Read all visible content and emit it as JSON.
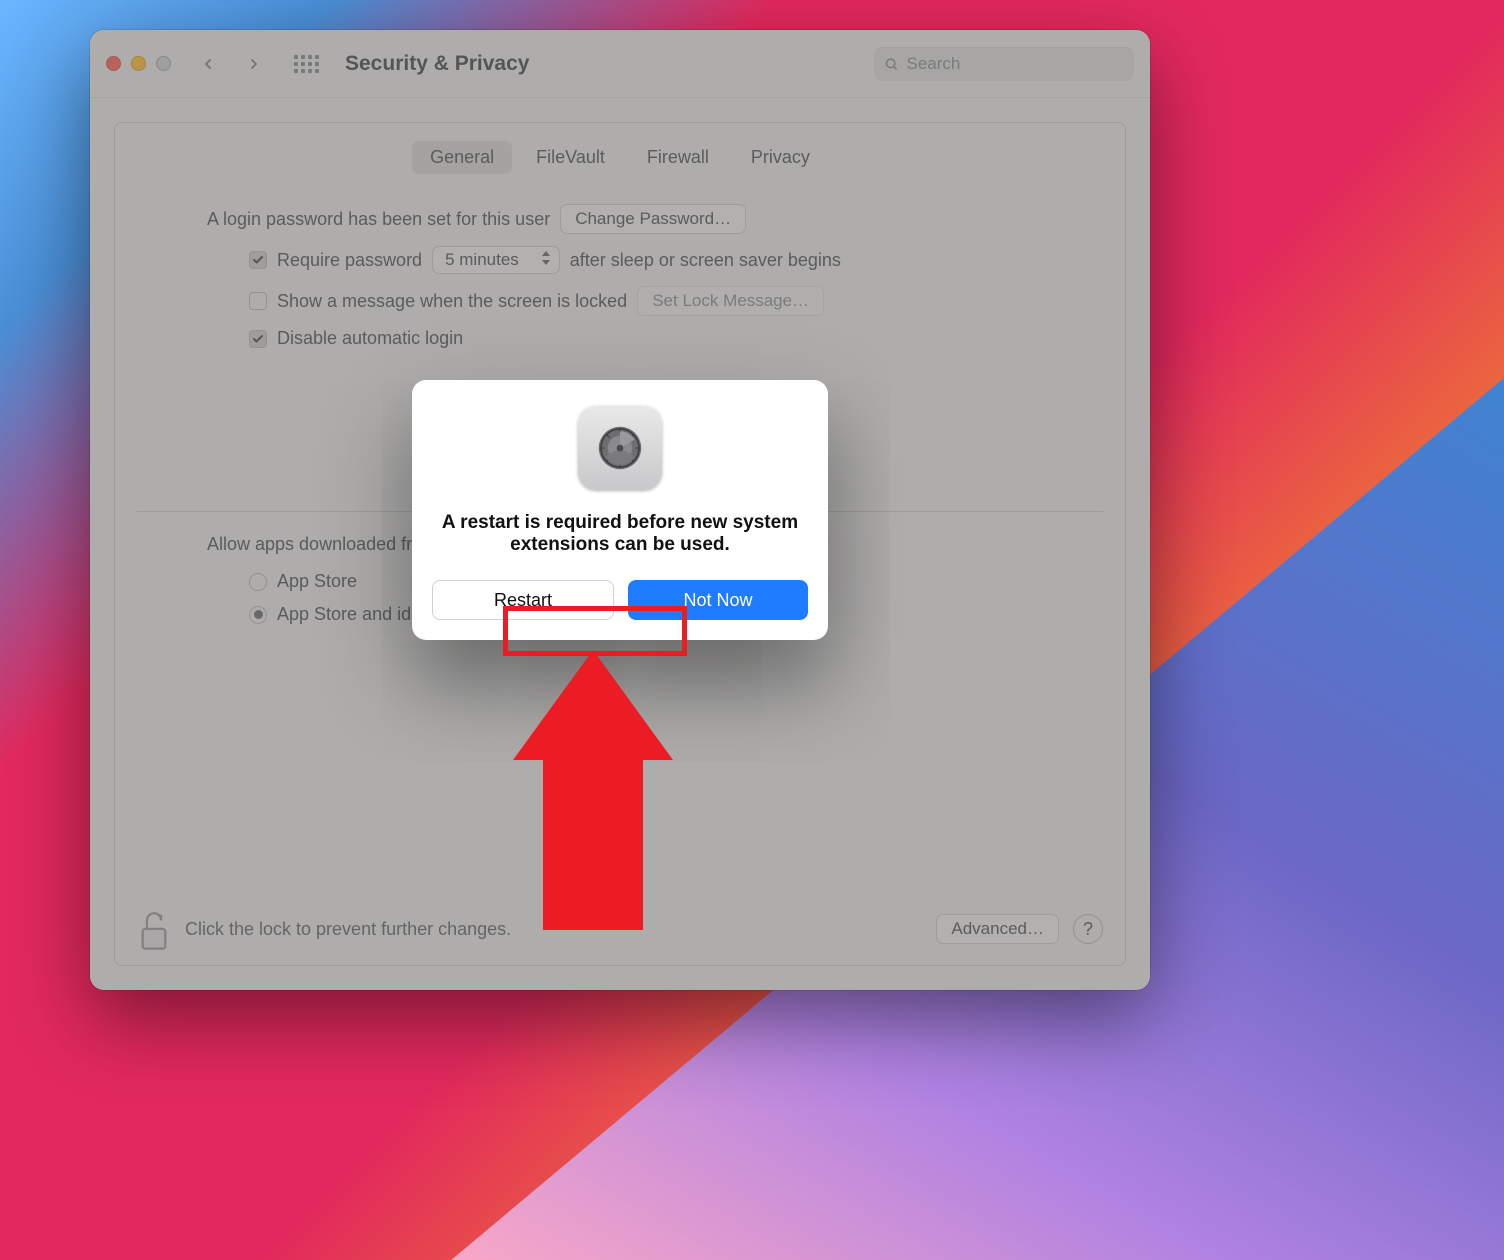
{
  "window": {
    "title": "Security & Privacy"
  },
  "search": {
    "placeholder": "Search"
  },
  "tabs": {
    "general": "General",
    "filevault": "FileVault",
    "firewall": "Firewall",
    "privacy": "Privacy"
  },
  "general": {
    "login_password_set": "A login password has been set for this user",
    "change_password": "Change Password…",
    "require_password_pre": "Require password",
    "require_password_delay": "5 minutes",
    "require_password_post": "after sleep or screen saver begins",
    "show_message": "Show a message when the screen is locked",
    "set_lock_message": "Set Lock Message…",
    "disable_auto": "Disable automatic login",
    "allow_apps": "Allow apps downloaded from:",
    "app_store": "App Store",
    "app_store_dev": "App Store and identified developers"
  },
  "footer": {
    "lock_text": "Click the lock to prevent further changes.",
    "advanced": "Advanced…",
    "help": "?"
  },
  "dialog": {
    "message": "A restart is required before new system extensions can be used.",
    "restart": "Restart",
    "not_now": "Not Now"
  }
}
